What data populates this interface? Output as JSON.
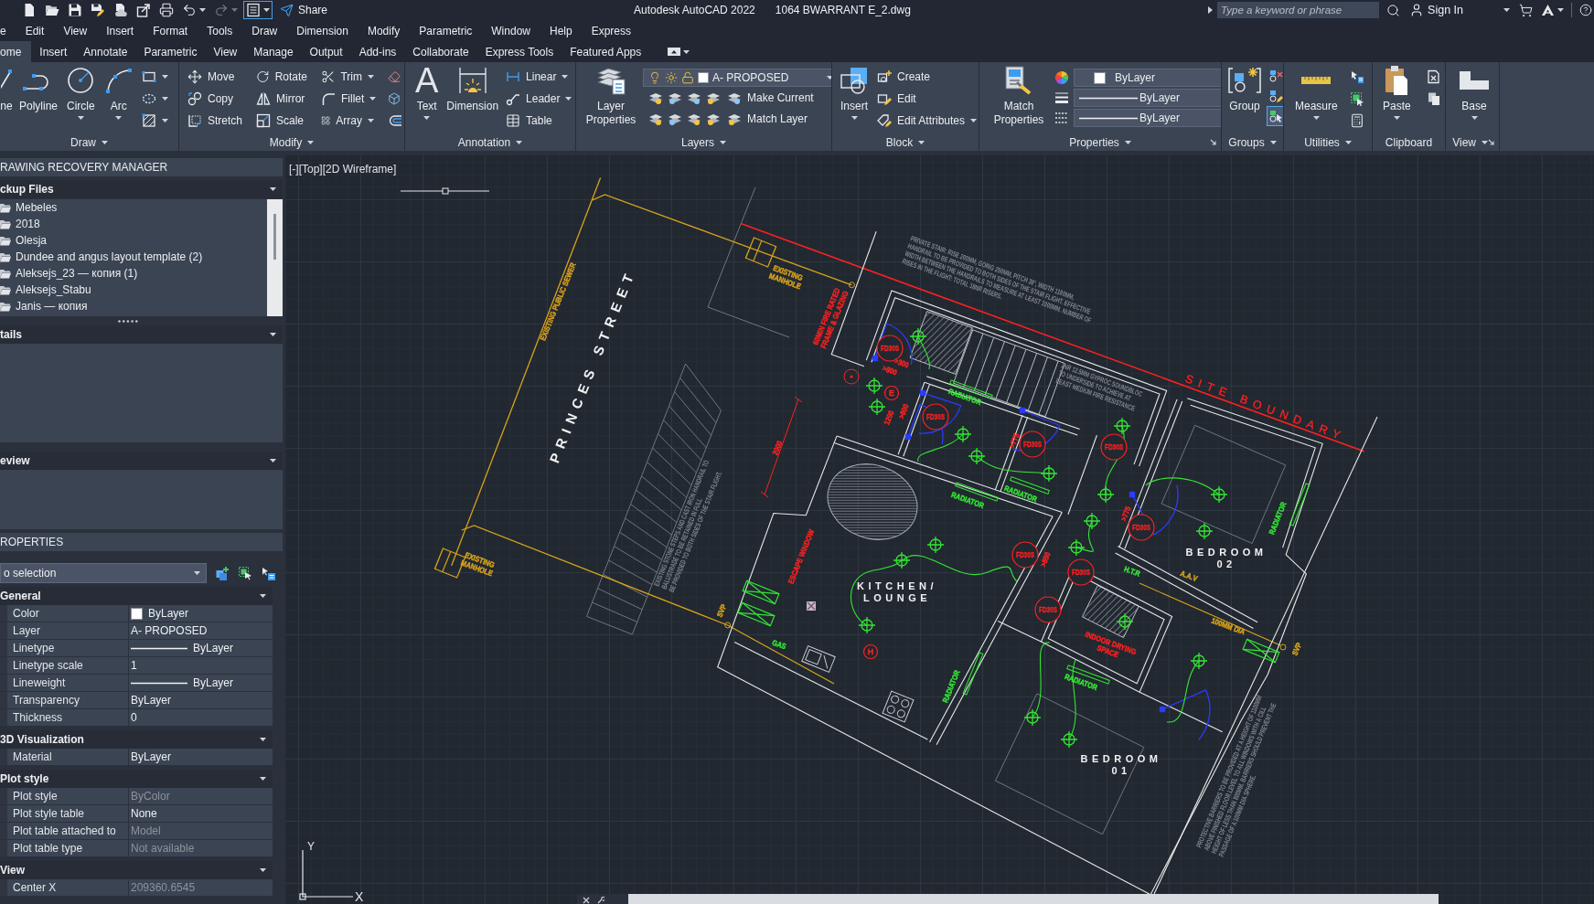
{
  "title_bar": {
    "quick_access": [
      {
        "caret": false,
        "on": false,
        "disabled": false
      },
      {
        "caret": false,
        "on": false,
        "disabled": false
      },
      {
        "caret": false,
        "on": false,
        "disabled": false
      },
      {
        "caret": false,
        "on": false,
        "disabled": false
      },
      {
        "caret": false,
        "on": false,
        "disabled": false
      },
      {
        "caret": false,
        "on": false,
        "disabled": false
      },
      {
        "caret": false,
        "on": false,
        "disabled": false
      },
      {
        "caret": true,
        "on": false,
        "disabled": false
      },
      {
        "caret": true,
        "on": false,
        "disabled": true
      },
      {
        "caret": true,
        "on": true,
        "disabled": false
      }
    ],
    "share": "Share",
    "app_name": "Autodesk AutoCAD 2022",
    "file_name": "1064 BWARRANT E_2.dwg",
    "search": {
      "placeholder": "Type a keyword or phrase"
    },
    "sign_in": "Sign In"
  },
  "menu_bar": [
    "e",
    "Edit",
    "View",
    "Insert",
    "Format",
    "Tools",
    "Draw",
    "Dimension",
    "Modify",
    "Parametric",
    "Window",
    "Help",
    "Express"
  ],
  "ribbon_tabs": [
    {
      "label": "ome",
      "selected": true
    },
    {
      "label": "Insert",
      "selected": false
    },
    {
      "label": "Annotate",
      "selected": false
    },
    {
      "label": "Parametric",
      "selected": false
    },
    {
      "label": "View",
      "selected": false
    },
    {
      "label": "Manage",
      "selected": false
    },
    {
      "label": "Output",
      "selected": false
    },
    {
      "label": "Add-ins",
      "selected": false
    },
    {
      "label": "Collaborate",
      "selected": false
    },
    {
      "label": "Express Tools",
      "selected": false
    },
    {
      "label": "Featured Apps",
      "selected": false
    }
  ],
  "ribbon_panels": [
    {
      "title": "Draw",
      "caret": true,
      "launcher": false,
      "columns": [
        {
          "kind": "large",
          "label": "ne",
          "caret": false
        },
        {
          "kind": "large",
          "label": "Polyline",
          "caret": false
        },
        {
          "kind": "large",
          "label": "Circle",
          "caret": true
        },
        {
          "kind": "large",
          "label": "Arc",
          "caret": true
        },
        {
          "kind": "stack",
          "items": [
            {
              "caret": true
            },
            {
              "caret": true
            },
            {
              "caret": true
            }
          ]
        }
      ]
    },
    {
      "title": "Modify",
      "caret": true,
      "launcher": false,
      "columns": [
        {
          "kind": "stack",
          "items": [
            {
              "label": "Move",
              "caret": false
            },
            {
              "label": "Copy",
              "caret": false
            },
            {
              "label": "Stretch",
              "caret": false
            }
          ]
        },
        {
          "kind": "stack",
          "items": [
            {
              "label": "Rotate",
              "caret": false
            },
            {
              "label": "Mirror",
              "caret": false
            },
            {
              "label": "Scale",
              "caret": false
            }
          ]
        },
        {
          "kind": "stack",
          "items": [
            {
              "label": "Trim",
              "caret": true
            },
            {
              "label": "Fillet",
              "caret": true
            },
            {
              "label": "Array",
              "caret": true
            }
          ]
        },
        {
          "kind": "stack",
          "items": [
            {
              "caret": false
            },
            {
              "caret": false
            },
            {
              "caret": false
            }
          ]
        }
      ]
    },
    {
      "title": "Annotation",
      "caret": true,
      "launcher": false,
      "columns": [
        {
          "kind": "large",
          "glyph": "A",
          "label": "Text",
          "caret": true
        },
        {
          "kind": "large",
          "label": "Dimension",
          "caret": false
        },
        {
          "kind": "stack",
          "items": [
            {
              "label": "Linear",
              "caret": true
            },
            {
              "label": "Leader",
              "caret": true
            },
            {
              "label": "Table",
              "caret": false
            }
          ]
        }
      ]
    },
    {
      "title": "Layers",
      "caret": true,
      "launcher": false,
      "columns": [
        {
          "kind": "large",
          "label": "Layer Properties",
          "caret": false
        },
        {
          "kind": "layer-control",
          "value": "A- PROPOSED",
          "buttons": [
            "Make Current",
            "Match Layer"
          ]
        }
      ]
    },
    {
      "title": "Block",
      "caret": true,
      "launcher": false,
      "columns": [
        {
          "kind": "large",
          "label": "Insert",
          "caret": true
        },
        {
          "kind": "stack",
          "items": [
            {
              "label": "Create",
              "caret": false
            },
            {
              "label": "Edit",
              "caret": false
            },
            {
              "label": "Edit Attributes",
              "caret": true
            }
          ]
        }
      ]
    },
    {
      "title": "Properties",
      "caret": true,
      "launcher": true,
      "columns": [
        {
          "kind": "large",
          "label": "Match Properties",
          "caret": false
        },
        {
          "kind": "property-dropdowns",
          "items": [
            {
              "kind": "color",
              "value": "ByLayer"
            },
            {
              "kind": "linetype",
              "value": "ByLayer"
            },
            {
              "kind": "lineweight",
              "value": "ByLayer"
            }
          ]
        }
      ]
    },
    {
      "title": "Groups",
      "caret": true,
      "launcher": false,
      "columns": [
        {
          "kind": "large",
          "label": "Group",
          "caret": false
        },
        {
          "kind": "stack",
          "items": [
            {
              "caret": false,
              "on": false
            },
            {
              "caret": false,
              "on": false
            },
            {
              "caret": false,
              "on": true
            }
          ]
        }
      ]
    },
    {
      "title": "Utilities",
      "caret": true,
      "launcher": false,
      "columns": [
        {
          "kind": "large",
          "label": "Measure",
          "caret": true
        },
        {
          "kind": "stack",
          "items": [
            {
              "caret": false
            },
            {
              "caret": false
            },
            {
              "caret": false
            }
          ]
        }
      ]
    },
    {
      "title": "Clipboard",
      "caret": false,
      "launcher": false,
      "columns": [
        {
          "kind": "large",
          "label": "Paste",
          "caret": true
        },
        {
          "kind": "stack",
          "items": [
            {
              "caret": false
            },
            {
              "caret": false
            }
          ]
        }
      ]
    },
    {
      "title": "View",
      "caret": true,
      "launcher": true,
      "columns": [
        {
          "kind": "large",
          "label": "Base",
          "caret": true
        }
      ]
    }
  ],
  "recovery_manager": {
    "title": "RAWING RECOVERY MANAGER",
    "sections": [
      {
        "title": "ckup Files",
        "expanded": true,
        "items": [
          "Mebeles",
          "2018",
          "Olesja",
          "Dundee and angus layout template (2)",
          "Aleksejs_23 — копия (1)",
          "Aleksejs_Stabu",
          "Janis — копия"
        ]
      },
      {
        "title": "tails",
        "expanded": true
      },
      {
        "title": "eview",
        "expanded": true
      }
    ]
  },
  "properties_palette": {
    "title": "ROPERTIES",
    "selection": "o selection",
    "categories": [
      {
        "title": "General",
        "expanded": true,
        "rows": [
          {
            "label": "Color",
            "value": "ByLayer",
            "kind": "color",
            "disabled": false
          },
          {
            "label": "Layer",
            "value": "A- PROPOSED",
            "kind": "text",
            "disabled": false
          },
          {
            "label": "Linetype",
            "value": "ByLayer",
            "kind": "line",
            "disabled": false
          },
          {
            "label": "Linetype scale",
            "value": "1",
            "kind": "text",
            "disabled": false
          },
          {
            "label": "Lineweight",
            "value": "ByLayer",
            "kind": "line",
            "disabled": false
          },
          {
            "label": "Transparency",
            "value": "ByLayer",
            "kind": "text",
            "disabled": false
          },
          {
            "label": "Thickness",
            "value": "0",
            "kind": "text",
            "disabled": false
          }
        ]
      },
      {
        "title": "3D Visualization",
        "expanded": true,
        "rows": [
          {
            "label": "Material",
            "value": "ByLayer",
            "kind": "text",
            "disabled": false
          }
        ]
      },
      {
        "title": "Plot style",
        "expanded": true,
        "rows": [
          {
            "label": "Plot style",
            "value": "ByColor",
            "kind": "text",
            "disabled": true
          },
          {
            "label": "Plot style table",
            "value": "None",
            "kind": "text",
            "disabled": false
          },
          {
            "label": "Plot table attached to",
            "value": "Model",
            "kind": "text",
            "disabled": true
          },
          {
            "label": "Plot table type",
            "value": "Not available",
            "kind": "text",
            "disabled": true
          }
        ]
      },
      {
        "title": "View",
        "expanded": true,
        "rows": [
          {
            "label": "Center X",
            "value": "209360.6545",
            "kind": "text",
            "disabled": true
          }
        ]
      }
    ]
  },
  "drawing": {
    "viewport_controls": [
      "[-]",
      "[Top]",
      "[2D Wireframe]"
    ],
    "labels": [
      {
        "kind": "street",
        "color": "#f2f2f2",
        "lines": [
          "PRINCES STREET"
        ]
      },
      {
        "kind": "boundary",
        "color": "#ff2020",
        "lines": [
          "SITE BOUNDARY"
        ]
      },
      {
        "kind": "callout",
        "color": "#d9a21b",
        "lines": [
          "EXISTING PUBLIC SEWER"
        ]
      },
      {
        "kind": "callout",
        "color": "#d9a21b",
        "lines": [
          "EXISTING",
          "MANHOLE"
        ]
      },
      {
        "kind": "callout",
        "color": "#d9a21b",
        "lines": [
          "EXISTING",
          "MANHOLE"
        ]
      },
      {
        "kind": "callout",
        "color": "#d9a21b",
        "lines": [
          "SVP"
        ]
      },
      {
        "kind": "callout",
        "color": "#d9a21b",
        "lines": [
          "SVP"
        ]
      },
      {
        "kind": "callout",
        "color": "#ff2020",
        "lines": [
          "60MIN FIRE RATED",
          "FRAME & GLAZING"
        ]
      },
      {
        "kind": "callout",
        "color": "#ff2020",
        "lines": [
          "ESCAPE WINDOW"
        ]
      },
      {
        "kind": "room",
        "color": "#f2f2f2",
        "lines": [
          "KITCHEN/",
          "LOUNGE"
        ]
      },
      {
        "kind": "room",
        "color": "#f2f2f2",
        "lines": [
          "BEDROOM",
          "02"
        ]
      },
      {
        "kind": "room",
        "color": "#f2f2f2",
        "lines": [
          "BEDROOM",
          "01"
        ]
      },
      {
        "kind": "callout",
        "color": "#33e633",
        "lines": [
          "RADIATOR"
        ]
      },
      {
        "kind": "callout",
        "color": "#33e633",
        "lines": [
          "RADIATOR"
        ]
      },
      {
        "kind": "callout",
        "color": "#33e633",
        "lines": [
          "RADIATOR"
        ]
      },
      {
        "kind": "callout",
        "color": "#33e633",
        "lines": [
          "RADIATOR"
        ]
      },
      {
        "kind": "callout",
        "color": "#33e633",
        "lines": [
          "RADIATOR"
        ]
      },
      {
        "kind": "callout",
        "color": "#33e633",
        "lines": [
          "RADIATOR"
        ]
      },
      {
        "kind": "callout",
        "color": "#33e633",
        "lines": [
          "GAS"
        ]
      },
      {
        "kind": "callout",
        "color": "#33e633",
        "lines": [
          "H.T.R"
        ]
      },
      {
        "kind": "callout",
        "color": "#ff2020",
        "lines": [
          "INDOOR DRYING",
          "SPACE"
        ]
      },
      {
        "kind": "callout",
        "color": "#d9a21b",
        "lines": [
          "100MM DIA"
        ]
      },
      {
        "kind": "callout",
        "color": "#d9a21b",
        "lines": [
          "A.A.V"
        ]
      },
      {
        "kind": "note",
        "color": "#80868f",
        "lines": [
          "PRIVATE STAIR: RISE 200MM, GOING 250MM, PITCH 38°, WIDTH 1180MM,",
          "HANDRAIL TO BE PROVIDED TO BOTH SIDES OF THE STAIR FLIGHT. EFFECTIVE",
          "WIDTH BETWEEN THE HANDRAILS TO MEASURE AT LEAST 1000MM. NUMBER OF",
          "RISES IN THE FLIGHT: TOTAL 18NR RISERS."
        ]
      },
      {
        "kind": "note",
        "color": "#80868f",
        "lines": [
          "2NR 12.5MM GYPROC SOUNDBLOC",
          "TO UNDERSIDE TO ACHIEVE AT",
          "LEAST MEDIUM FIRE RESISTANCE"
        ]
      },
      {
        "kind": "note",
        "color": "#80868f",
        "lines": [
          "EXISTING STONE STEPS AND CAST IRON HANDRAIL TO",
          "BALUSTRADE TO BE RETAINED IN FULL",
          "BE PROVIDED TO BOTH SIDES OF THE STAIR FLIGHT."
        ]
      },
      {
        "kind": "note",
        "color": "#80868f",
        "lines": [
          "PROTECTIVE BARRIERS TO BE PROVIDED AT A HEIGHT OF 1100MM",
          "ABOVE FINISHED FLOOR LEVEL TO ALL WINDOWS WITH A CILL",
          "HEIGHT OF LESS THAN 800MM. BARRIERS SHOULD PREVENT THE",
          "PASSAGE OF A 100MM DIA SPHERE."
        ]
      },
      {
        "kind": "dimension",
        "color": "#ff2020",
        "lines": [
          "2000"
        ]
      },
      {
        "kind": "dimension",
        "color": "#ff2020",
        "lines": [
          ">300"
        ]
      },
      {
        "kind": "dimension",
        "color": "#ff2020",
        "lines": [
          ">800"
        ]
      },
      {
        "kind": "dimension",
        "color": "#ff2020",
        "lines": [
          ">800"
        ]
      },
      {
        "kind": "dimension",
        "color": "#ff2020",
        "lines": [
          "1200"
        ]
      },
      {
        "kind": "dimension",
        "color": "#ff2020",
        "lines": [
          ">775"
        ]
      },
      {
        "kind": "dimension",
        "color": "#ff2020",
        "lines": [
          ">775"
        ]
      },
      {
        "kind": "dimension",
        "color": "#ff2020",
        "lines": [
          ">850"
        ]
      }
    ],
    "tags": [
      {
        "text": "FD30S"
      },
      {
        "text": "FD30S"
      },
      {
        "text": "FD30S"
      },
      {
        "text": "FD30S"
      },
      {
        "text": "FD30S"
      },
      {
        "text": "FD30S"
      },
      {
        "text": "FD30S"
      },
      {
        "text": "FD30S"
      },
      {
        "text": "E"
      },
      {
        "text": "H"
      }
    ],
    "ucs_axes": [
      "X",
      "Y"
    ]
  }
}
